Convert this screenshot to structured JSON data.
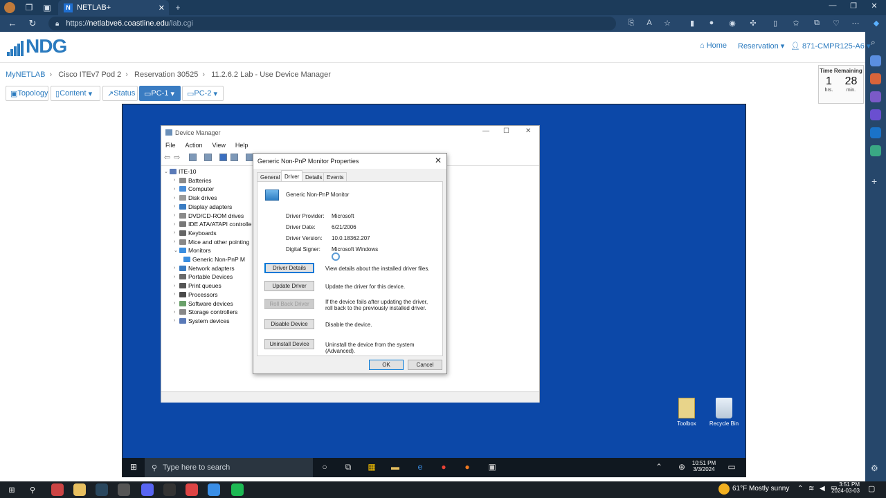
{
  "browser": {
    "tab_title": "NETLAB+",
    "tab_favicon": "N",
    "address_host": "netlabve6.coastline.edu",
    "address_path": "/lab.cgi",
    "address_scheme": "https://"
  },
  "ndg": {
    "logo": "NDG",
    "nav_home": "Home",
    "nav_reservation": "Reservation",
    "nav_user": "871-CMPR125-A6"
  },
  "breadcrumb": [
    "MyNETLAB",
    "Cisco ITEv7 Pod 2",
    "Reservation 30525",
    "11.2.6.2 Lab - Use Device Manager"
  ],
  "lab_tabs": [
    "Topology",
    "Content",
    "Status",
    "PC-1",
    "PC-2"
  ],
  "time_remaining": {
    "label": "Time Remaining",
    "hours": "1",
    "hours_unit": "hrs.",
    "minutes": "28",
    "minutes_unit": "min."
  },
  "device_manager": {
    "title": "Device Manager",
    "menu": [
      "File",
      "Action",
      "View",
      "Help"
    ],
    "tree_root": "ITE-10",
    "tree": [
      "Batteries",
      "Computer",
      "Disk drives",
      "Display adapters",
      "DVD/CD-ROM drives",
      "IDE ATA/ATAPI controlle",
      "Keyboards",
      "Mice and other pointing",
      "Monitors",
      "Generic Non-PnP M",
      "Network adapters",
      "Portable Devices",
      "Print queues",
      "Processors",
      "Software devices",
      "Storage controllers",
      "System devices"
    ]
  },
  "props": {
    "title": "Generic Non-PnP Monitor Properties",
    "tabs": [
      "General",
      "Driver",
      "Details",
      "Events"
    ],
    "device_name": "Generic Non-PnP Monitor",
    "rows": [
      {
        "label": "Driver Provider:",
        "value": "Microsoft"
      },
      {
        "label": "Driver Date:",
        "value": "6/21/2006"
      },
      {
        "label": "Driver Version:",
        "value": "10.0.18362.207"
      },
      {
        "label": "Digital Signer:",
        "value": "Microsoft Windows"
      }
    ],
    "buttons": [
      {
        "label": "Driver Details",
        "desc": "View details about the installed driver files."
      },
      {
        "label": "Update Driver",
        "desc": "Update the driver for this device."
      },
      {
        "label": "Roll Back Driver",
        "desc": "If the device fails after updating the driver, roll back to the previously installed driver."
      },
      {
        "label": "Disable Device",
        "desc": "Disable the device."
      },
      {
        "label": "Uninstall Device",
        "desc": "Uninstall the device from the system (Advanced)."
      }
    ],
    "ok": "OK",
    "cancel": "Cancel"
  },
  "desktop_icons": [
    "Toolbox",
    "Recycle Bin"
  ],
  "remote_taskbar": {
    "search_placeholder": "Type here to search",
    "time": "10:51 PM",
    "date": "3/3/2024"
  },
  "host_taskbar": {
    "weather": "61°F  Mostly sunny",
    "time": "3:51 PM",
    "date": "2024-03-03"
  },
  "colors": {
    "accent": "#2b7bbf",
    "remote_desktop": "#0c48a8",
    "browser_chrome": "#26476b"
  }
}
